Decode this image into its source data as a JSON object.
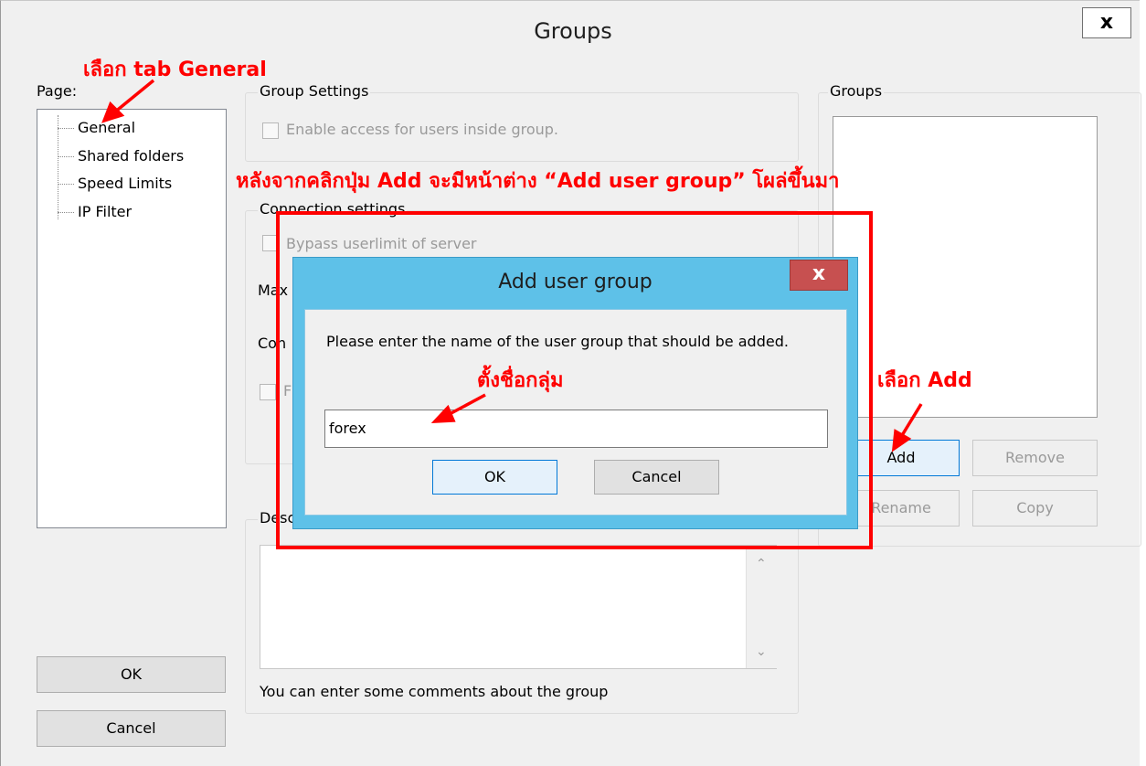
{
  "window": {
    "title": "Groups",
    "close_glyph": "x"
  },
  "page_panel": {
    "label": "Page:",
    "items": [
      "General",
      "Shared folders",
      "Speed Limits",
      "IP Filter"
    ]
  },
  "group_settings": {
    "legend": "Group Settings",
    "enable_access": "Enable access for users inside group."
  },
  "connection_settings": {
    "legend": "Connection settings",
    "bypass": "Bypass userlimit of server",
    "max_prefix": "Max",
    "con_prefix": "Con",
    "f_prefix": "F"
  },
  "description": {
    "legend_prefix": "Desc",
    "hint": "You can enter some comments about the group"
  },
  "groups_panel": {
    "legend": "Groups",
    "add": "Add",
    "remove": "Remove",
    "rename": "Rename",
    "copy": "Copy"
  },
  "footer": {
    "ok": "OK",
    "cancel": "Cancel"
  },
  "dialog": {
    "title": "Add user group",
    "close_glyph": "x",
    "prompt": "Please enter the name of the user group that should be added.",
    "input_value": "forex",
    "ok": "OK",
    "cancel": "Cancel"
  },
  "annotations": {
    "select_tab_general_prefix": "เลือก ",
    "select_tab_general_bold": "tab General",
    "after_click_prefix": "หลังจากคลิกปุ่ม ",
    "after_click_add": "Add",
    "after_click_mid": " จะมีหน้าต่าง ",
    "after_click_window": "“Add user group”",
    "after_click_suffix": " โผล่ขึ้นมา",
    "name_group": "ตั้งชื่อกลุ่ม",
    "select_add_prefix": "เลือก ",
    "select_add_bold": "Add"
  },
  "colors": {
    "annotation": "#ff0000",
    "dialog_frame": "#5ec1e8",
    "dialog_close": "#c75050"
  }
}
